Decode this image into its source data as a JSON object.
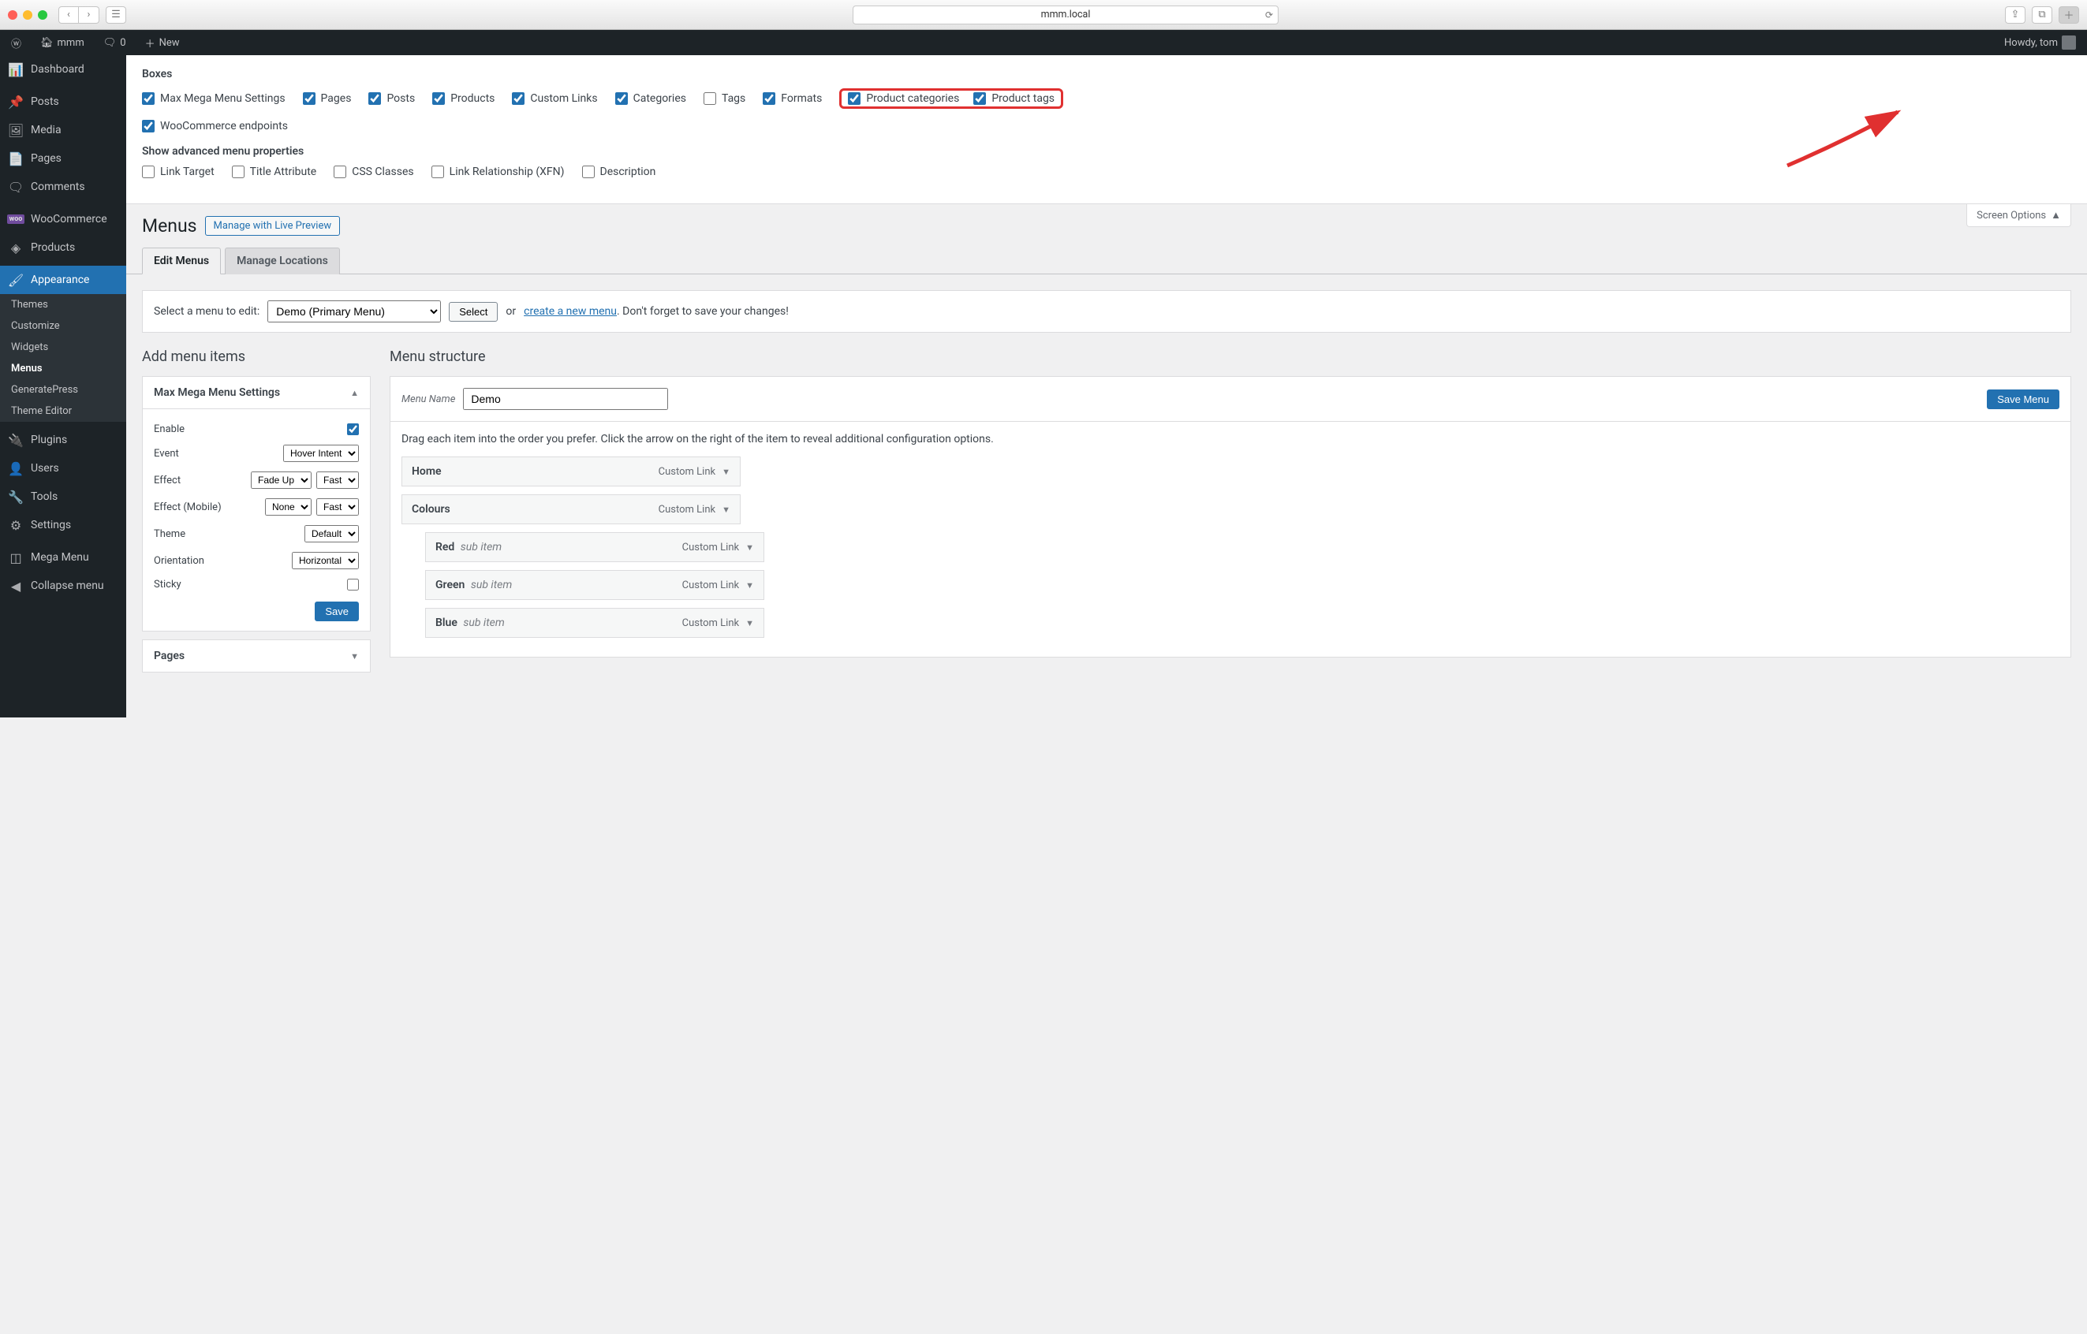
{
  "browser": {
    "url": "mmm.local"
  },
  "adminbar": {
    "site": "mmm",
    "comments": "0",
    "new": "New",
    "howdy": "Howdy, tom"
  },
  "sidebar": {
    "dashboard": "Dashboard",
    "posts": "Posts",
    "media": "Media",
    "pages": "Pages",
    "comments": "Comments",
    "woocommerce": "WooCommerce",
    "products": "Products",
    "appearance": "Appearance",
    "appearance_sub": {
      "themes": "Themes",
      "customize": "Customize",
      "widgets": "Widgets",
      "menus": "Menus",
      "generatepress": "GeneratePress",
      "theme_editor": "Theme Editor"
    },
    "plugins": "Plugins",
    "users": "Users",
    "tools": "Tools",
    "settings": "Settings",
    "mega_menu": "Mega Menu",
    "collapse": "Collapse menu"
  },
  "screen_options": {
    "title": "Boxes",
    "boxes": {
      "max_mega_menu": "Max Mega Menu Settings",
      "pages": "Pages",
      "posts": "Posts",
      "products": "Products",
      "custom_links": "Custom Links",
      "categories": "Categories",
      "tags": "Tags",
      "formats": "Formats",
      "product_categories": "Product categories",
      "product_tags": "Product tags",
      "woocommerce_endpoints": "WooCommerce endpoints"
    },
    "advanced_title": "Show advanced menu properties",
    "advanced": {
      "link_target": "Link Target",
      "title_attribute": "Title Attribute",
      "css_classes": "CSS Classes",
      "link_relationship": "Link Relationship (XFN)",
      "description": "Description"
    },
    "toggle": "Screen Options"
  },
  "page": {
    "title": "Menus",
    "live_preview": "Manage with Live Preview",
    "tab_edit": "Edit Menus",
    "tab_locations": "Manage Locations"
  },
  "select_menu": {
    "label": "Select a menu to edit:",
    "value": "Demo (Primary Menu)",
    "select_btn": "Select",
    "or": "or",
    "create_link": "create a new menu",
    "suffix": ". Don't forget to save your changes!"
  },
  "add_items": {
    "heading": "Add menu items",
    "mm_settings": "Max Mega Menu Settings",
    "enable": "Enable",
    "event": "Event",
    "event_val": "Hover Intent",
    "effect": "Effect",
    "effect_val": "Fade Up",
    "effect_speed": "Fast",
    "effect_mobile": "Effect (Mobile)",
    "effect_mobile_val": "None",
    "effect_mobile_speed": "Fast",
    "theme": "Theme",
    "theme_val": "Default",
    "orientation": "Orientation",
    "orientation_val": "Horizontal",
    "sticky": "Sticky",
    "save": "Save",
    "pages_acc": "Pages"
  },
  "structure": {
    "heading": "Menu structure",
    "menu_name_lbl": "Menu Name",
    "menu_name_val": "Demo",
    "save_menu": "Save Menu",
    "hint": "Drag each item into the order you prefer. Click the arrow on the right of the item to reveal additional configuration options.",
    "items": [
      {
        "title": "Home",
        "type": "Custom Link",
        "depth": 0,
        "sub": ""
      },
      {
        "title": "Colours",
        "type": "Custom Link",
        "depth": 0,
        "sub": ""
      },
      {
        "title": "Red",
        "type": "Custom Link",
        "depth": 1,
        "sub": "sub item"
      },
      {
        "title": "Green",
        "type": "Custom Link",
        "depth": 1,
        "sub": "sub item"
      },
      {
        "title": "Blue",
        "type": "Custom Link",
        "depth": 1,
        "sub": "sub item"
      }
    ]
  }
}
